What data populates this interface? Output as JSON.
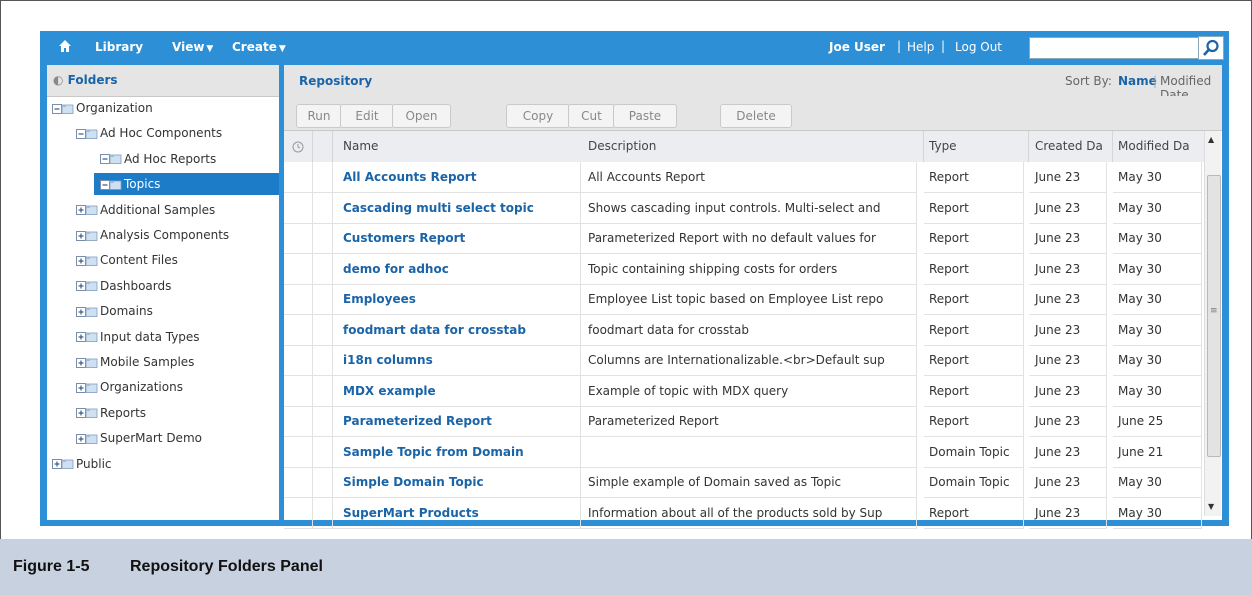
{
  "topbar": {
    "nav": [
      {
        "label": "Library",
        "caret": false
      },
      {
        "label": "View",
        "caret": true
      },
      {
        "label": "Create",
        "caret": true
      }
    ],
    "user": "Joe User",
    "help": "Help",
    "logout": "Log Out",
    "search_value": ""
  },
  "folders": {
    "title": "Folders",
    "items": [
      {
        "label": "Organization",
        "expanded": true,
        "level": 0
      },
      {
        "label": "Ad Hoc Components",
        "expanded": true,
        "level": 1
      },
      {
        "label": "Ad Hoc Reports",
        "expanded": null,
        "level": 2
      },
      {
        "label": "Topics",
        "expanded": true,
        "level": 2,
        "selected": true
      },
      {
        "label": "Additional Samples",
        "expanded": false,
        "level": 1
      },
      {
        "label": "Analysis Components",
        "expanded": false,
        "level": 1
      },
      {
        "label": "Content Files",
        "expanded": false,
        "level": 1
      },
      {
        "label": "Dashboards",
        "expanded": false,
        "level": 1
      },
      {
        "label": "Domains",
        "expanded": false,
        "level": 1
      },
      {
        "label": "Input data Types",
        "expanded": false,
        "level": 1
      },
      {
        "label": "Mobile Samples",
        "expanded": false,
        "level": 1
      },
      {
        "label": "Organizations",
        "expanded": false,
        "level": 1
      },
      {
        "label": "Reports",
        "expanded": false,
        "level": 1
      },
      {
        "label": "SuperMart Demo",
        "expanded": false,
        "level": 1
      },
      {
        "label": "Public",
        "expanded": false,
        "level": 0
      }
    ]
  },
  "repository": {
    "title": "Repository",
    "sort_by_label": "Sort By:",
    "sort_name": "Name",
    "sort_modified": "Modified Date",
    "toolbar": [
      "Run",
      "Edit",
      "Open",
      "Copy",
      "Cut",
      "Paste",
      "Delete"
    ],
    "columns": [
      "Name",
      "Description",
      "Type",
      "Created Da",
      "Modified Da"
    ],
    "rows": [
      [
        "All Accounts Report",
        "All Accounts Report",
        "Report",
        "June 23",
        "May 30"
      ],
      [
        "Cascading multi select topic",
        "Shows cascading input controls. Multi-select and",
        "Report",
        "June 23",
        "May 30"
      ],
      [
        "Customers Report",
        "Parameterized Report with no default values for",
        "Report",
        "June 23",
        "May 30"
      ],
      [
        "demo for adhoc",
        "Topic containing shipping costs for orders",
        "Report",
        "June 23",
        "May 30"
      ],
      [
        "Employees",
        "Employee List topic based on Employee List repo",
        "Report",
        "June 23",
        "May 30"
      ],
      [
        "foodmart data for crosstab",
        "foodmart data for crosstab",
        "Report",
        "June 23",
        "May 30"
      ],
      [
        "i18n columns",
        "Columns are Internationalizable.<br>Default sup",
        "Report",
        "June 23",
        "May 30"
      ],
      [
        "MDX example",
        "Example of topic with MDX query",
        "Report",
        "June 23",
        "May 30"
      ],
      [
        "Parameterized Report",
        "Parameterized Report",
        "Report",
        "June 23",
        "June 25"
      ],
      [
        "Sample Topic from Domain",
        "",
        "Domain Topic",
        "June 23",
        "June 21"
      ],
      [
        "Simple Domain Topic",
        "Simple example of Domain saved as Topic",
        "Domain Topic",
        "June 23",
        "May 30"
      ],
      [
        "SuperMart Products",
        "Information about all of the products sold by Sup",
        "Report",
        "June 23",
        "May 30"
      ]
    ]
  },
  "caption": {
    "number": "Figure 1-5",
    "title": "Repository Folders Panel"
  }
}
